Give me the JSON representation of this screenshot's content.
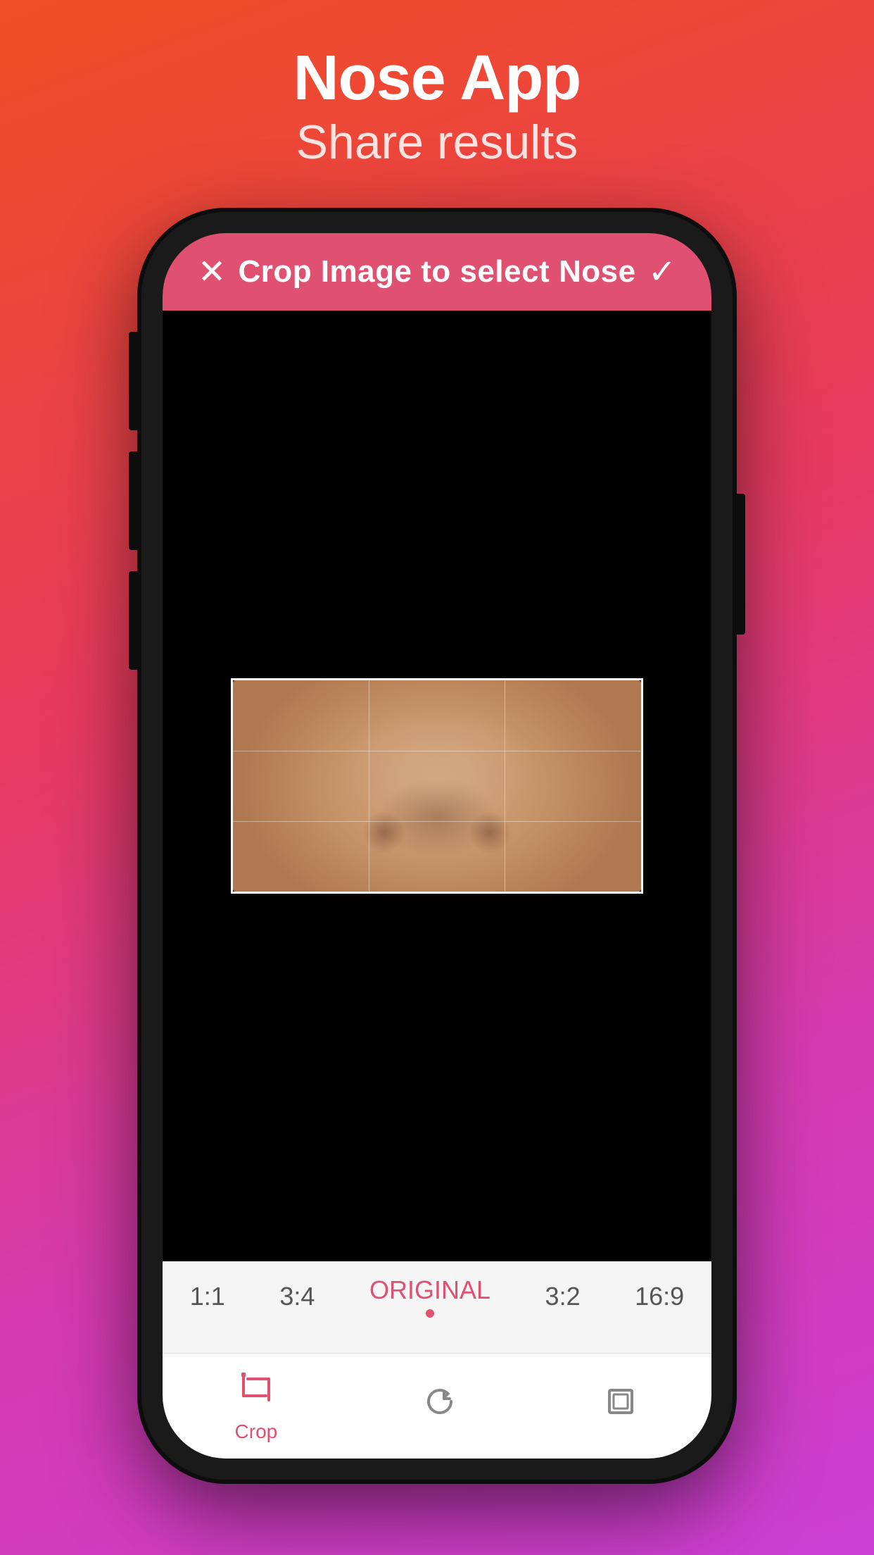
{
  "header": {
    "title": "Nose App",
    "subtitle": "Share results"
  },
  "phone": {
    "crop_bar": {
      "title": "Crop Image to select Nose",
      "close_icon": "✕",
      "confirm_icon": "✓"
    },
    "ratio_bar": {
      "options": [
        {
          "label": "1:1",
          "active": false
        },
        {
          "label": "3:4",
          "active": false
        },
        {
          "label": "ORIGINAL",
          "active": true
        },
        {
          "label": "3:2",
          "active": false
        },
        {
          "label": "16:9",
          "active": false
        }
      ]
    },
    "toolbar": {
      "items": [
        {
          "label": "Crop",
          "icon": "crop",
          "active": true
        },
        {
          "label": "",
          "icon": "rotate",
          "active": false
        },
        {
          "label": "",
          "icon": "expand",
          "active": false
        }
      ]
    }
  }
}
